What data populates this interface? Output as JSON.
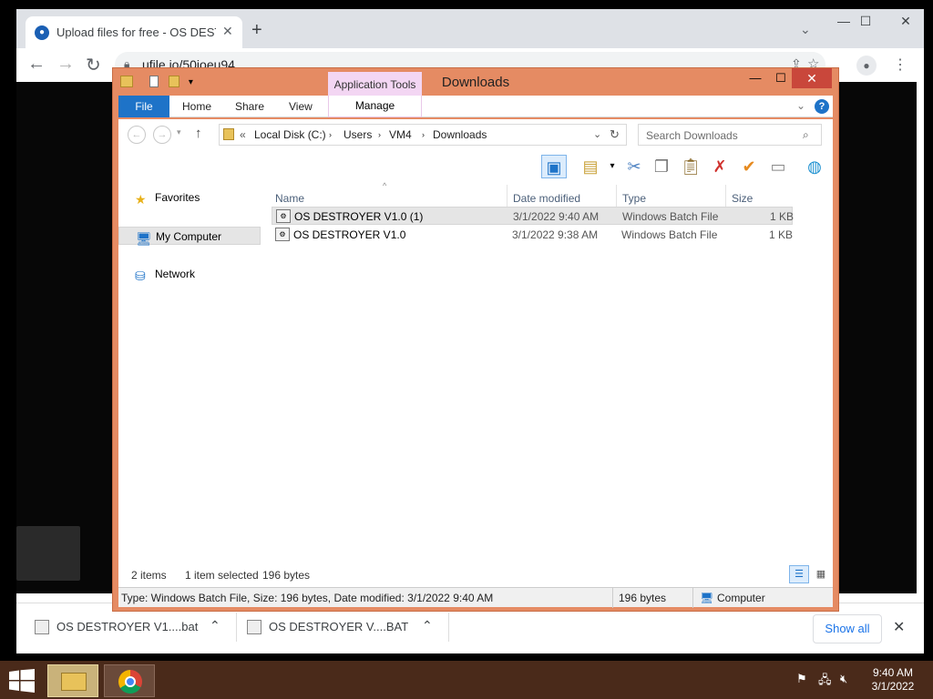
{
  "browser": {
    "tab_title": "Upload files for free - OS DESTRO",
    "tab_close": "✕",
    "new_tab": "+",
    "url": "ufile.io/50joeu94",
    "download_shelf": {
      "items": [
        {
          "name": "OS DESTROYER V1....bat"
        },
        {
          "name": "OS DESTROYER V....BAT"
        }
      ],
      "show_all": "Show all"
    }
  },
  "explorer": {
    "window_title": "Downloads",
    "context_tab": "Application Tools",
    "ribbon_tabs": {
      "file": "File",
      "home": "Home",
      "share": "Share",
      "view": "View",
      "manage": "Manage"
    },
    "breadcrumb": {
      "prefix": "«",
      "items": [
        "Local Disk (C:)",
        "Users",
        "VM4",
        "Downloads"
      ]
    },
    "search_placeholder": "Search Downloads",
    "nav": {
      "favorites": "Favorites",
      "computer": "My Computer",
      "network": "Network"
    },
    "columns": {
      "name": "Name",
      "date": "Date modified",
      "type": "Type",
      "size": "Size"
    },
    "files": [
      {
        "name": "OS DESTROYER V1.0 (1)",
        "date": "3/1/2022 9:40 AM",
        "type": "Windows Batch File",
        "size": "1 KB",
        "selected": true
      },
      {
        "name": "OS DESTROYER V1.0",
        "date": "3/1/2022 9:38 AM",
        "type": "Windows Batch File",
        "size": "1 KB",
        "selected": false
      }
    ],
    "status": {
      "items": "2 items",
      "selected": "1 item selected",
      "bytes": "196 bytes"
    },
    "details": {
      "info": "Type: Windows Batch File, Size: 196 bytes, Date modified: 3/1/2022 9:40 AM",
      "size": "196 bytes",
      "location": "Computer"
    }
  },
  "taskbar": {
    "time": "9:40 AM",
    "date": "3/1/2022"
  },
  "colors": {
    "accent": "#1e73c8",
    "explorer_frame": "#e58b63",
    "close": "#c9473b",
    "taskbar": "#4a2a1a"
  }
}
